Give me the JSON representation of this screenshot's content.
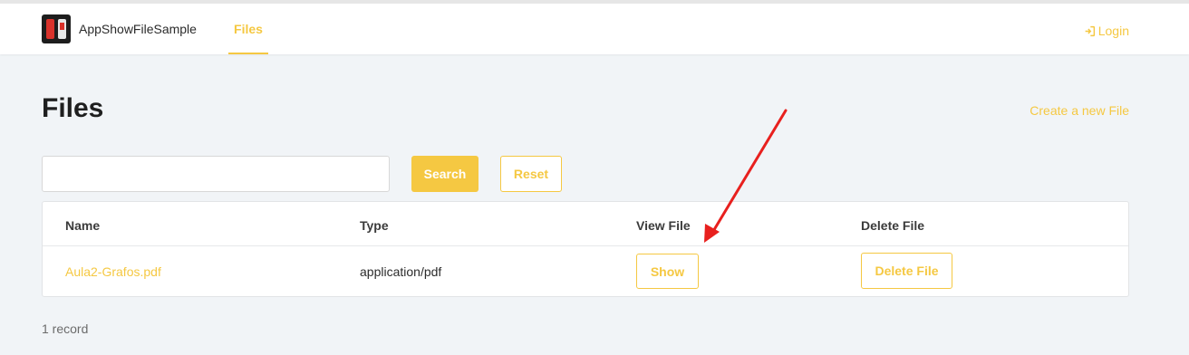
{
  "header": {
    "app_name": "AppShowFileSample",
    "nav_files": "Files",
    "login": "Login"
  },
  "page": {
    "title": "Files",
    "create_link": "Create a new File"
  },
  "search": {
    "value": "",
    "search_label": "Search",
    "reset_label": "Reset"
  },
  "table": {
    "headers": [
      "Name",
      "Type",
      "View File",
      "Delete File"
    ],
    "rows": [
      {
        "name": "Aula2-Grafos.pdf",
        "type": "application/pdf",
        "show_label": "Show",
        "delete_label": "Delete File"
      }
    ]
  },
  "footer": {
    "record_count": "1 record"
  },
  "colors": {
    "accent": "#f5c842",
    "annotation": "#e8201e",
    "background": "#f1f4f7"
  },
  "icons": {
    "login": "sign-in-icon",
    "annotation": "red-arrow-annotation"
  }
}
